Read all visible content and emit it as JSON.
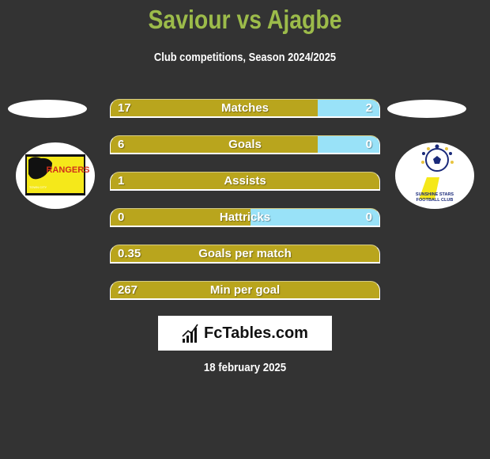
{
  "header": {
    "title": "Saviour vs Ajagbe",
    "subtitle": "Club competitions, Season 2024/2025"
  },
  "teams": {
    "left": {
      "logo_name": "rangers-logo",
      "logo_text": "RANGERS",
      "logo_subtext": "TOWN CITY"
    },
    "right": {
      "logo_name": "sunshine-stars-logo",
      "logo_text_line1": "SUNSHINE STARS",
      "logo_text_line2": "FOOTBALL CLUB"
    }
  },
  "colors": {
    "left_bar": "#b9a51d",
    "right_bar": "#99e2f8",
    "title": "#9cbb4a",
    "background": "#333333"
  },
  "stats": [
    {
      "label": "Matches",
      "left": "17",
      "right": "2",
      "right_share": 0.23
    },
    {
      "label": "Goals",
      "left": "6",
      "right": "0",
      "right_share": 0.23
    },
    {
      "label": "Assists",
      "left": "1",
      "right": "",
      "right_share": 0
    },
    {
      "label": "Hattricks",
      "left": "0",
      "right": "0",
      "right_share": 0.48
    },
    {
      "label": "Goals per match",
      "left": "0.35",
      "right": "",
      "right_share": 0
    },
    {
      "label": "Min per goal",
      "left": "267",
      "right": "",
      "right_share": 0
    }
  ],
  "brand": {
    "name": "FcTables.com",
    "icon": "bar-chart-icon"
  },
  "footer": {
    "date": "18 february 2025"
  }
}
